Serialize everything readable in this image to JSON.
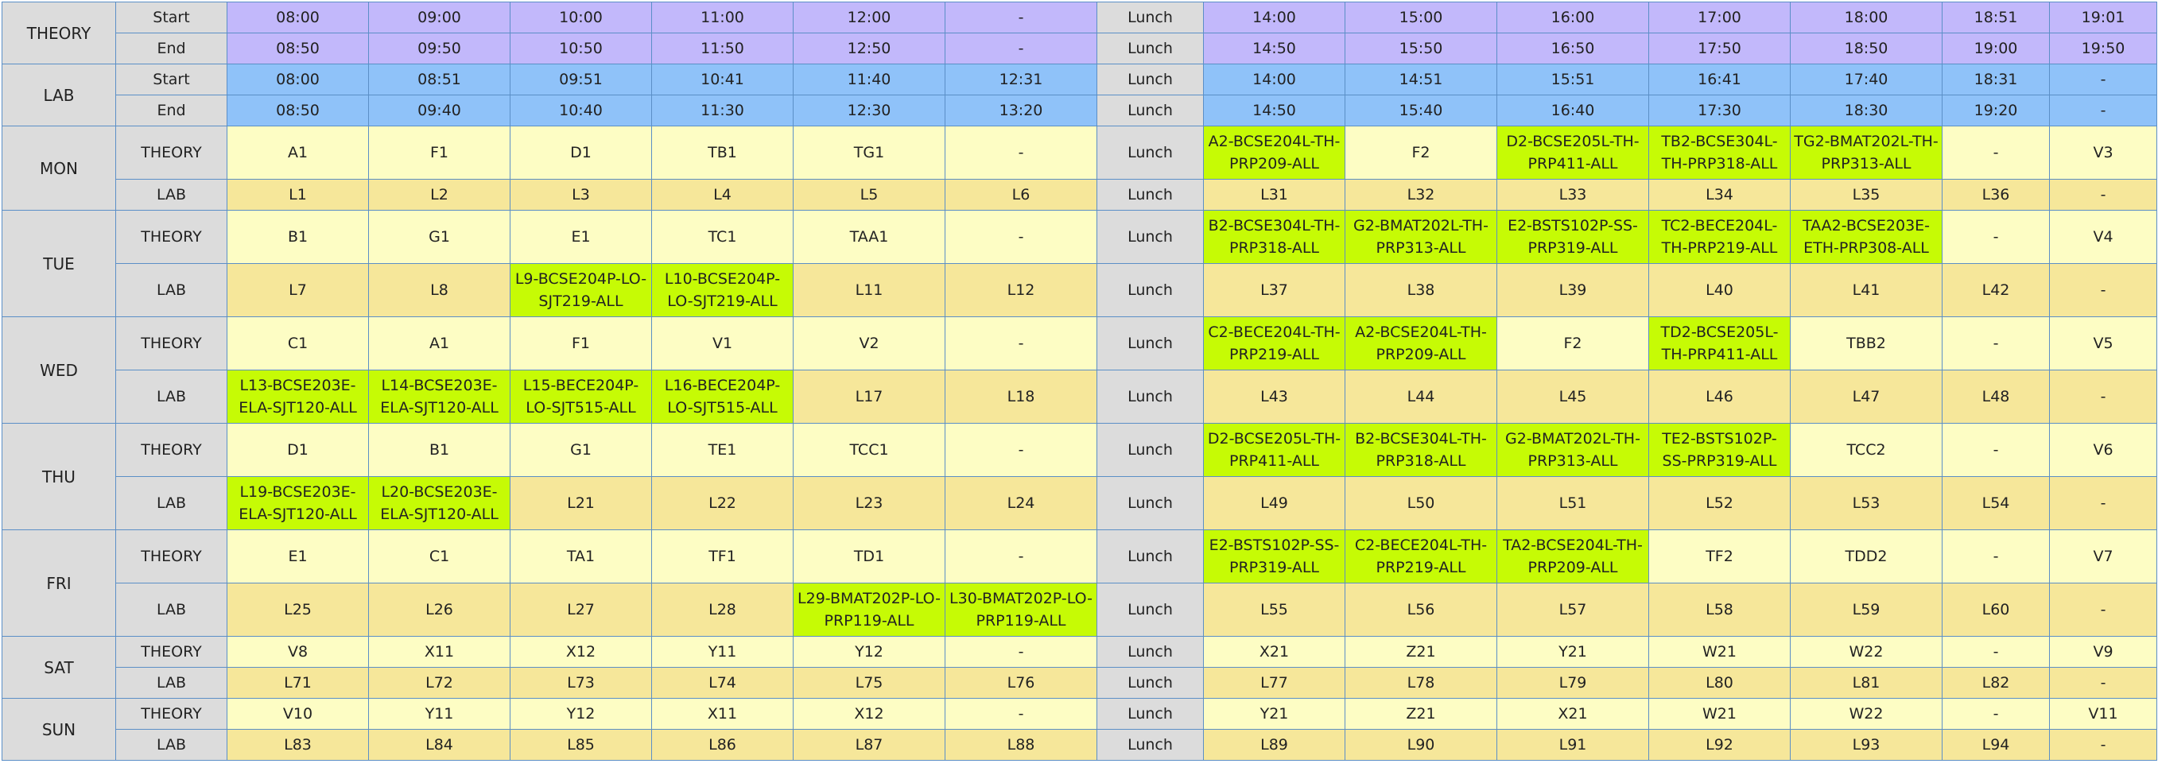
{
  "header": {
    "theory": {
      "label": "THEORY",
      "start_label": "Start",
      "end_label": "End",
      "start": [
        "08:00",
        "09:00",
        "10:00",
        "11:00",
        "12:00",
        "-",
        "Lunch",
        "14:00",
        "15:00",
        "16:00",
        "17:00",
        "18:00",
        "18:51",
        "19:01"
      ],
      "end": [
        "08:50",
        "09:50",
        "10:50",
        "11:50",
        "12:50",
        "-",
        "Lunch",
        "14:50",
        "15:50",
        "16:50",
        "17:50",
        "18:50",
        "19:00",
        "19:50"
      ]
    },
    "lab": {
      "label": "LAB",
      "start_label": "Start",
      "end_label": "End",
      "start": [
        "08:00",
        "08:51",
        "09:51",
        "10:41",
        "11:40",
        "12:31",
        "Lunch",
        "14:00",
        "14:51",
        "15:51",
        "16:41",
        "17:40",
        "18:31",
        "-"
      ],
      "end": [
        "08:50",
        "09:40",
        "10:40",
        "11:30",
        "12:30",
        "13:20",
        "Lunch",
        "14:50",
        "15:40",
        "16:40",
        "17:30",
        "18:30",
        "19:20",
        "-"
      ]
    }
  },
  "days": [
    {
      "name": "MON",
      "theory_label": "THEORY",
      "lab_label": "LAB",
      "theory": [
        "A1",
        "F1",
        "D1",
        "TB1",
        "TG1",
        "-",
        "Lunch",
        "A2-BCSE204L-TH-PRP209-ALL",
        "F2",
        "D2-BCSE205L-TH-PRP411-ALL",
        "TB2-BCSE304L-TH-PRP318-ALL",
        "TG2-BMAT202L-TH-PRP313-ALL",
        "-",
        "V3"
      ],
      "lab": [
        "L1",
        "L2",
        "L3",
        "L4",
        "L5",
        "L6",
        "Lunch",
        "L31",
        "L32",
        "L33",
        "L34",
        "L35",
        "L36",
        "-"
      ]
    },
    {
      "name": "TUE",
      "theory_label": "THEORY",
      "lab_label": "LAB",
      "theory": [
        "B1",
        "G1",
        "E1",
        "TC1",
        "TAA1",
        "-",
        "Lunch",
        "B2-BCSE304L-TH-PRP318-ALL",
        "G2-BMAT202L-TH-PRP313-ALL",
        "E2-BSTS102P-SS-PRP319-ALL",
        "TC2-BECE204L-TH-PRP219-ALL",
        "TAA2-BCSE203E-ETH-PRP308-ALL",
        "-",
        "V4"
      ],
      "lab": [
        "L7",
        "L8",
        "L9-BCSE204P-LO-SJT219-ALL",
        "L10-BCSE204P-LO-SJT219-ALL",
        "L11",
        "L12",
        "Lunch",
        "L37",
        "L38",
        "L39",
        "L40",
        "L41",
        "L42",
        "-"
      ]
    },
    {
      "name": "WED",
      "theory_label": "THEORY",
      "lab_label": "LAB",
      "theory": [
        "C1",
        "A1",
        "F1",
        "V1",
        "V2",
        "-",
        "Lunch",
        "C2-BECE204L-TH-PRP219-ALL",
        "A2-BCSE204L-TH-PRP209-ALL",
        "F2",
        "TD2-BCSE205L-TH-PRP411-ALL",
        "TBB2",
        "-",
        "V5"
      ],
      "lab": [
        "L13-BCSE203E-ELA-SJT120-ALL",
        "L14-BCSE203E-ELA-SJT120-ALL",
        "L15-BECE204P-LO-SJT515-ALL",
        "L16-BECE204P-LO-SJT515-ALL",
        "L17",
        "L18",
        "Lunch",
        "L43",
        "L44",
        "L45",
        "L46",
        "L47",
        "L48",
        "-"
      ]
    },
    {
      "name": "THU",
      "theory_label": "THEORY",
      "lab_label": "LAB",
      "theory": [
        "D1",
        "B1",
        "G1",
        "TE1",
        "TCC1",
        "-",
        "Lunch",
        "D2-BCSE205L-TH-PRP411-ALL",
        "B2-BCSE304L-TH-PRP318-ALL",
        "G2-BMAT202L-TH-PRP313-ALL",
        "TE2-BSTS102P-SS-PRP319-ALL",
        "TCC2",
        "-",
        "V6"
      ],
      "lab": [
        "L19-BCSE203E-ELA-SJT120-ALL",
        "L20-BCSE203E-ELA-SJT120-ALL",
        "L21",
        "L22",
        "L23",
        "L24",
        "Lunch",
        "L49",
        "L50",
        "L51",
        "L52",
        "L53",
        "L54",
        "-"
      ]
    },
    {
      "name": "FRI",
      "theory_label": "THEORY",
      "lab_label": "LAB",
      "theory": [
        "E1",
        "C1",
        "TA1",
        "TF1",
        "TD1",
        "-",
        "Lunch",
        "E2-BSTS102P-SS-PRP319-ALL",
        "C2-BECE204L-TH-PRP219-ALL",
        "TA2-BCSE204L-TH-PRP209-ALL",
        "TF2",
        "TDD2",
        "-",
        "V7"
      ],
      "lab": [
        "L25",
        "L26",
        "L27",
        "L28",
        "L29-BMAT202P-LO-PRP119-ALL",
        "L30-BMAT202P-LO-PRP119-ALL",
        "Lunch",
        "L55",
        "L56",
        "L57",
        "L58",
        "L59",
        "L60",
        "-"
      ]
    },
    {
      "name": "SAT",
      "theory_label": "THEORY",
      "lab_label": "LAB",
      "theory": [
        "V8",
        "X11",
        "X12",
        "Y11",
        "Y12",
        "-",
        "Lunch",
        "X21",
        "Z21",
        "Y21",
        "W21",
        "W22",
        "-",
        "V9"
      ],
      "lab": [
        "L71",
        "L72",
        "L73",
        "L74",
        "L75",
        "L76",
        "Lunch",
        "L77",
        "L78",
        "L79",
        "L80",
        "L81",
        "L82",
        "-"
      ]
    },
    {
      "name": "SUN",
      "theory_label": "THEORY",
      "lab_label": "LAB",
      "theory": [
        "V10",
        "Y11",
        "Y12",
        "X11",
        "X12",
        "-",
        "Lunch",
        "Y21",
        "Z21",
        "X21",
        "W21",
        "W22",
        "-",
        "V11"
      ],
      "lab": [
        "L83",
        "L84",
        "L85",
        "L86",
        "L87",
        "L88",
        "Lunch",
        "L89",
        "L90",
        "L91",
        "L92",
        "L93",
        "L94",
        "-"
      ]
    }
  ],
  "colors": {
    "theory_header": "#c2b8fb",
    "lab_header": "#8fc2f9",
    "theory_cell": "#fdfdc4",
    "lab_cell": "#f6e79a",
    "label_cell": "#dcdcdc",
    "registered_slot": "#c6fb05",
    "border": "#5b8fc7"
  }
}
